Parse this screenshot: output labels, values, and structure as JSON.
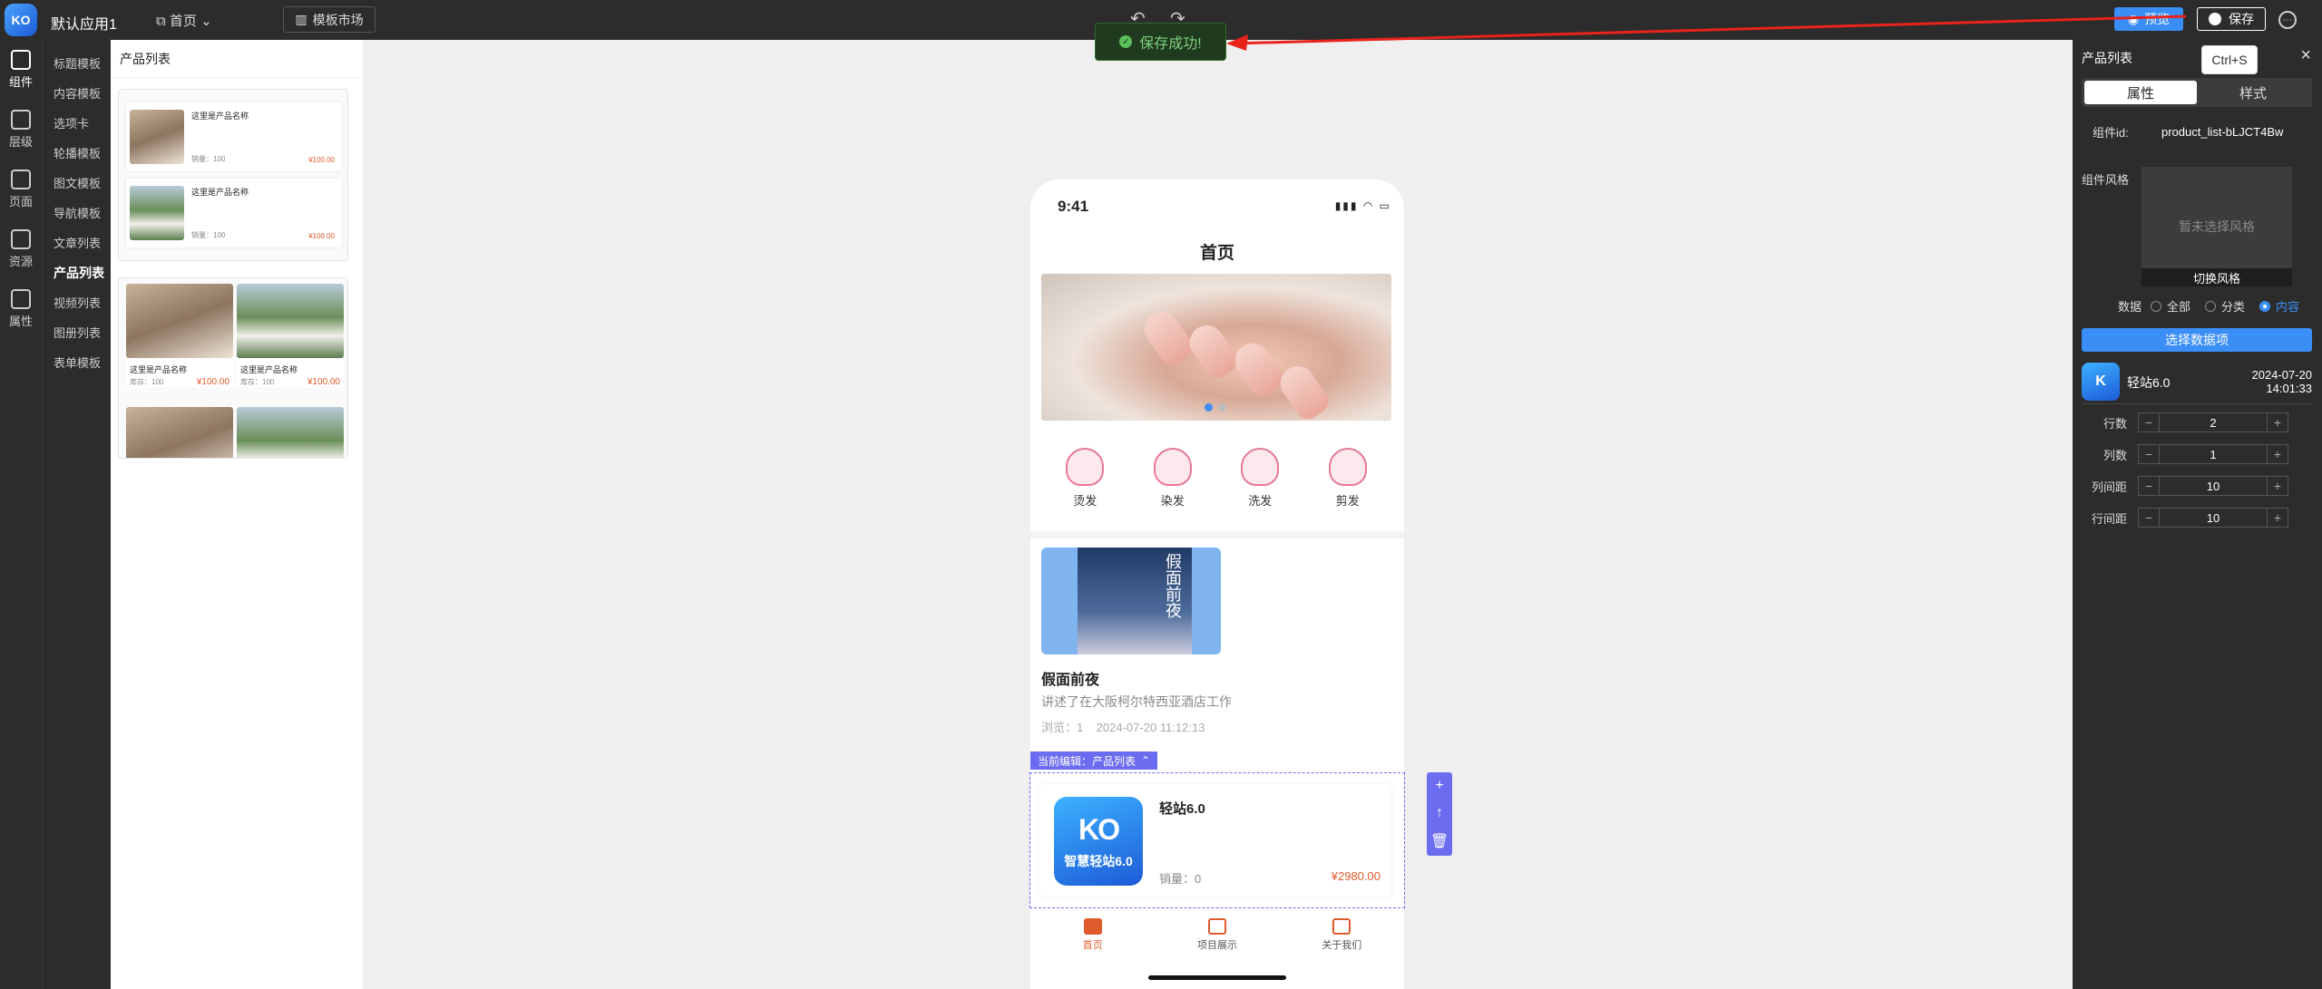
{
  "topbar": {
    "logo_text": "KO",
    "app_name": "默认应用1",
    "page_select": "首页",
    "template_market": "模板市场",
    "preview_label": "预览",
    "save_label": "保存",
    "tooltip": "Ctrl+S",
    "toast": "保存成功!"
  },
  "leftnav": [
    {
      "label": "组件",
      "icon": "grid-icon"
    },
    {
      "label": "层级",
      "icon": "layers-icon"
    },
    {
      "label": "页面",
      "icon": "page-icon"
    },
    {
      "label": "资源",
      "icon": "image-icon"
    },
    {
      "label": "属性",
      "icon": "brush-icon"
    }
  ],
  "categories": [
    "标题模板",
    "内容模板",
    "选项卡",
    "轮播模板",
    "图文模板",
    "导航模板",
    "文章列表",
    "产品列表",
    "视频列表",
    "图册列表",
    "表单模板"
  ],
  "template_panel": {
    "title": "产品列表",
    "list_items": [
      {
        "name": "这里是产品名称",
        "sales": "销量：100",
        "price": "¥100.00"
      },
      {
        "name": "这里是产品名称",
        "sales": "销量：100",
        "price": "¥100.00"
      }
    ],
    "grid_items": [
      {
        "name": "这里是产品名称",
        "stock": "库存：100",
        "price": "¥100.00"
      },
      {
        "name": "这里是产品名称",
        "stock": "库存：100",
        "price": "¥100.00"
      }
    ]
  },
  "phone": {
    "time": "9:41",
    "status_icons": "▮▮▮ ◠ ▭",
    "title": "首页",
    "icons": [
      "烫发",
      "染发",
      "洗发",
      "剪发"
    ],
    "poster_text": "假面前夜",
    "article": {
      "title": "假面前夜",
      "desc": "讲述了在大阪柯尔特西亚酒店工作",
      "meta": "浏览：1    2024-07-20 11:12:13"
    },
    "current_edit": "当前编辑：产品列表",
    "product": {
      "logo_mark": "KO",
      "logo_text": "智慧轻站6.0",
      "name": "轻站6.0",
      "sales": "销量：0",
      "price": "¥2980.00"
    },
    "tabs": [
      {
        "label": "首页",
        "active": true
      },
      {
        "label": "项目展示",
        "active": false
      },
      {
        "label": "关于我们",
        "active": false
      }
    ]
  },
  "rpanel": {
    "title": "产品列表",
    "tab_props": "属性",
    "tab_style": "样式",
    "component_id_label": "组件id:",
    "component_id": "product_list-bLJCT4Bw",
    "style_label": "组件风格",
    "no_style": "暂未选择风格",
    "switch_style": "切换风格",
    "data_label": "数据",
    "data_options": [
      "全部",
      "分类",
      "内容"
    ],
    "data_selected": "内容",
    "pick_data": "选择数据项",
    "data_item": {
      "name": "轻站6.0",
      "date": "2024-07-20",
      "time": "14:01:33"
    },
    "steppers": [
      {
        "label": "行数",
        "value": "2"
      },
      {
        "label": "列数",
        "value": "1"
      },
      {
        "label": "列间距",
        "value": "10"
      },
      {
        "label": "行间距",
        "value": "10"
      }
    ]
  },
  "colors": {
    "accent": "#3a8ef6",
    "price": "#e05a2b",
    "edit": "#6c6cf0",
    "panel": "#2c2c2c"
  }
}
